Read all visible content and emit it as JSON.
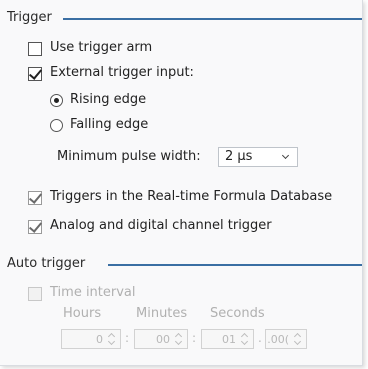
{
  "trigger": {
    "title": "Trigger",
    "use_trigger_arm": {
      "label": "Use trigger arm",
      "checked": false
    },
    "external_trigger_input": {
      "label": "External trigger input:",
      "checked": true
    },
    "rising_edge": {
      "label": "Rising edge",
      "selected": true
    },
    "falling_edge": {
      "label": "Falling edge",
      "selected": false
    },
    "min_pulse_width": {
      "label": "Minimum pulse width:",
      "value": "2 µs"
    },
    "realtime_formula": {
      "label": "Triggers in the Real-time Formula Database",
      "checked": true
    },
    "analog_digital": {
      "label": "Analog and digital channel trigger",
      "checked": true
    }
  },
  "auto_trigger": {
    "title": "Auto trigger",
    "time_interval": {
      "label": "Time interval",
      "checked": false,
      "enabled": false
    },
    "headers": {
      "hours": "Hours",
      "minutes": "Minutes",
      "seconds": "Seconds"
    },
    "values": {
      "hours": "0",
      "minutes": "00",
      "seconds": "01",
      "millis": ".00("
    },
    "separators": {
      "colon": ":",
      "dot": "."
    }
  },
  "colors": {
    "section_line": "#3b6fa3",
    "disabled_text": "#b0b0b0"
  }
}
